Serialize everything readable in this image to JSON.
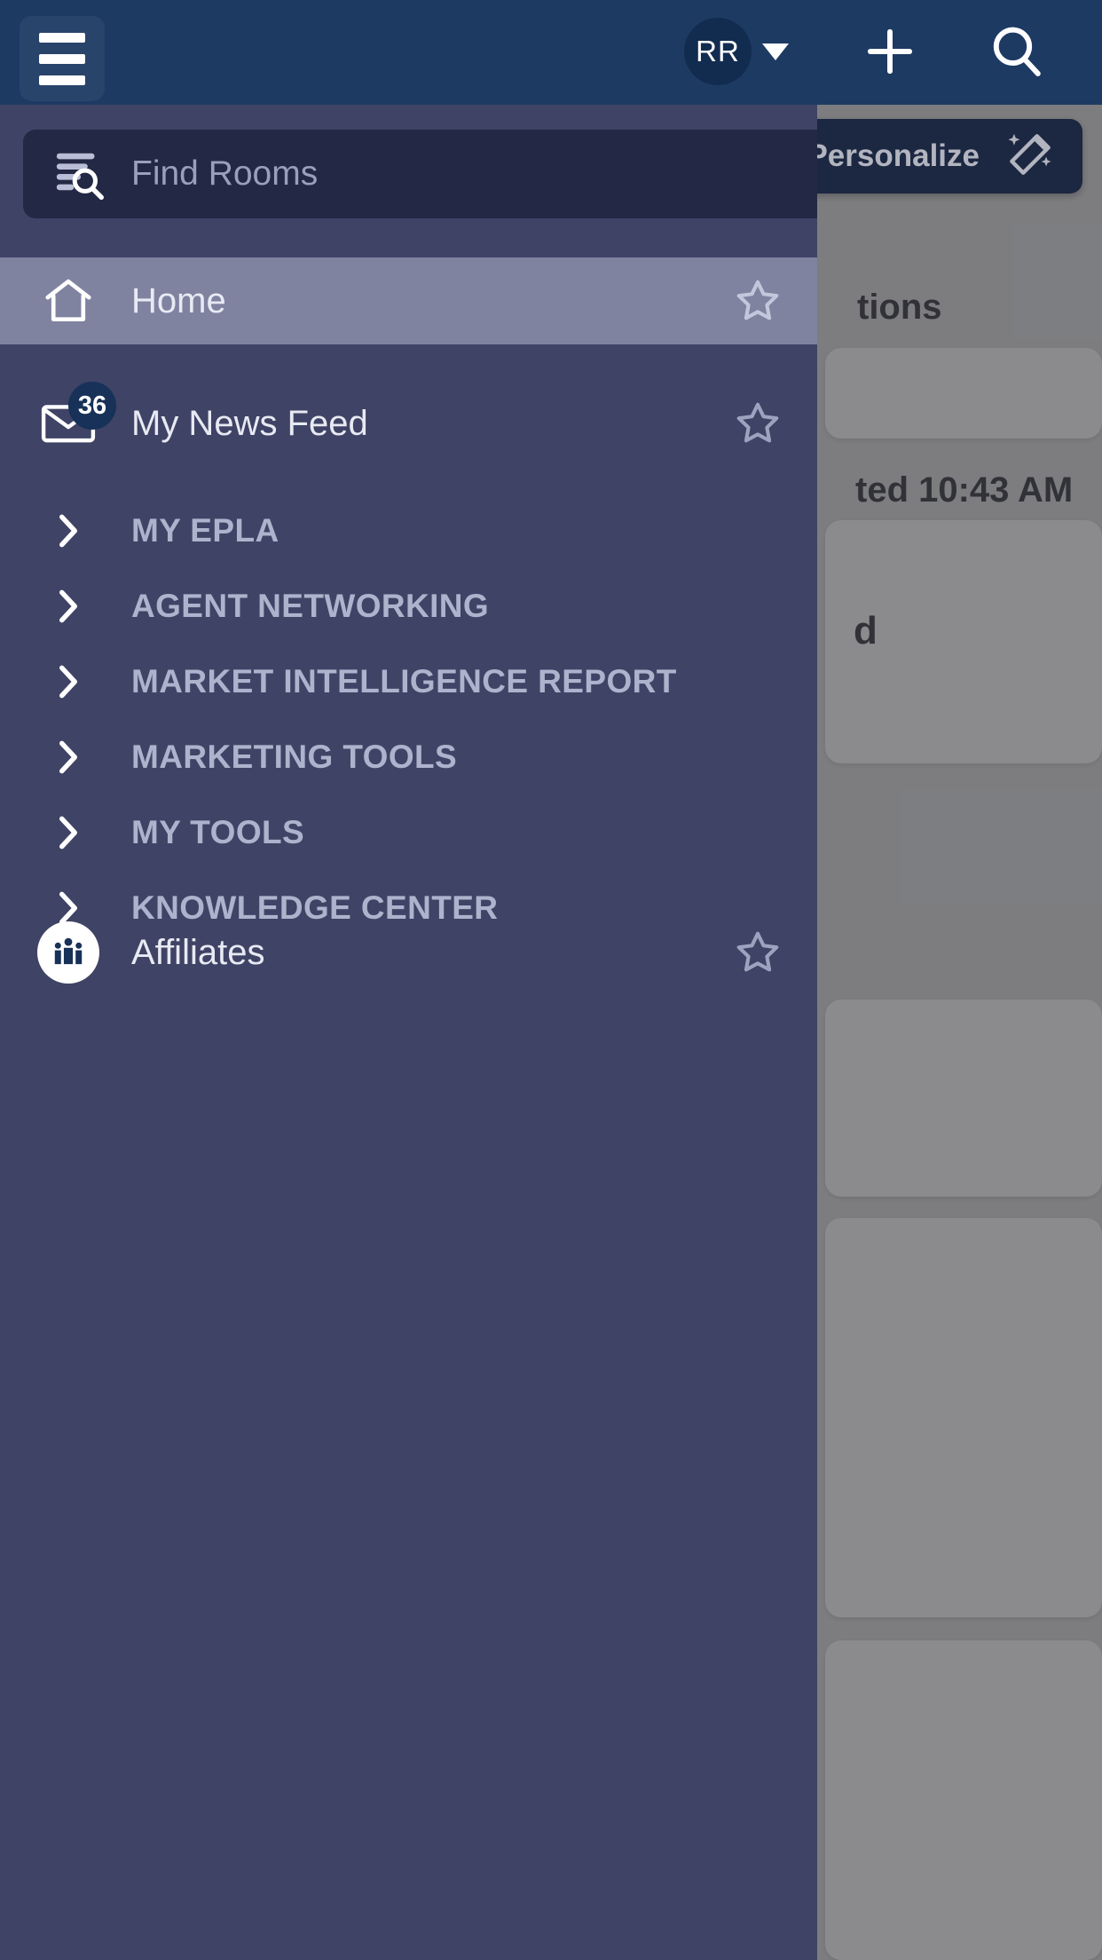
{
  "topbar": {
    "menu_icon": "hamburger-icon",
    "avatar_initials": "RR",
    "avatar_caret_icon": "chevron-down-icon",
    "add_icon": "plus-icon",
    "search_icon": "search-icon",
    "background_color": "#1d3a63"
  },
  "drawer": {
    "background_color": "#3f4365",
    "search": {
      "placeholder": "Find Rooms",
      "icon": "filter-search-icon",
      "value": ""
    },
    "items": [
      {
        "label": "Home",
        "icon": "home-icon",
        "star_icon": "star-outline-icon",
        "selected": true,
        "type": "link"
      },
      {
        "label": "My News Feed",
        "icon": "envelope-icon",
        "badge": "36",
        "star_icon": "star-outline-icon",
        "selected": false,
        "type": "link"
      },
      {
        "label": "MY EPLA",
        "icon": "chevron-right-icon",
        "type": "section"
      },
      {
        "label": "AGENT NETWORKING",
        "icon": "chevron-right-icon",
        "type": "section"
      },
      {
        "label": "MARKET INTELLIGENCE REPORT",
        "icon": "chevron-right-icon",
        "type": "section"
      },
      {
        "label": "MARKETING TOOLS",
        "icon": "chevron-right-icon",
        "type": "section"
      },
      {
        "label": "MY TOOLS",
        "icon": "chevron-right-icon",
        "type": "section"
      },
      {
        "label": "KNOWLEDGE CENTER",
        "icon": "chevron-right-icon",
        "type": "section"
      },
      {
        "label": "Affiliates",
        "icon": "people-group-icon",
        "star_icon": "star-outline-icon",
        "selected": false,
        "type": "link"
      }
    ],
    "selected_background_color": "#7f83a0"
  },
  "background": {
    "personalize_label": "Personalize",
    "personalize_icon": "magic-wand-icon",
    "personalize_background_color": "#16233f",
    "partial_text_1": "tions",
    "partial_text_2": "ted 10:43 AM",
    "partial_text_3": "d"
  }
}
